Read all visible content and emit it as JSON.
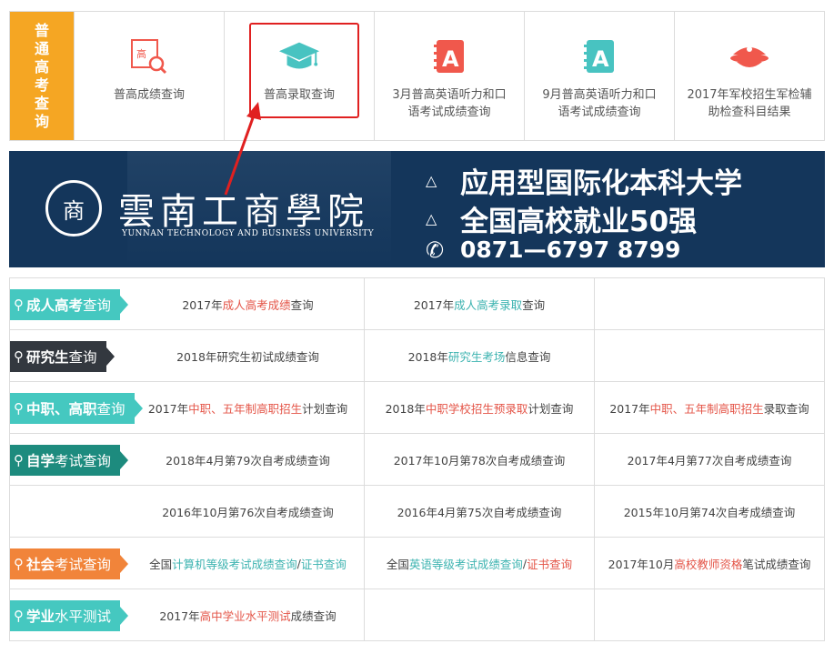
{
  "nav": {
    "vertical_label": [
      "普",
      "通",
      "高",
      "考",
      "查",
      "询"
    ],
    "items": [
      {
        "label": "普高成绩查询",
        "icon": "score-search-icon"
      },
      {
        "label": "普高录取查询",
        "icon": "graduation-cap-icon"
      },
      {
        "label": "3月普高英语听力和口语考试成绩查询",
        "icon": "notebook-a-icon"
      },
      {
        "label": "9月普高英语听力和口语考试成绩查询",
        "icon": "notebook-a-icon"
      },
      {
        "label": "2017年军校招生军检辅助检查科目结果",
        "icon": "military-cap-icon"
      }
    ],
    "colors": {
      "orange": "#f5a623",
      "red": "#f0584c",
      "teal": "#48c3c1"
    }
  },
  "banner": {
    "seal_char": "商",
    "university_cn": "雲南工商學院",
    "university_en": "YUNNAN TECHNOLOGY AND BUSINESS UNIVERSITY",
    "slogan1": "应用型国际化本科大学",
    "slogan2": "全国高校就业50强",
    "phone": "0871—6797 8799",
    "bg_color": "#14365b"
  },
  "rows": [
    {
      "tag": {
        "bold": "成人高考",
        "normal": "查询"
      },
      "cells": [
        [
          {
            "t": "2017年"
          },
          {
            "t": "成人高考成绩",
            "c": "red"
          },
          {
            "t": "查询"
          }
        ],
        [
          {
            "t": "2017年"
          },
          {
            "t": "成人高考录取",
            "c": "tealt"
          },
          {
            "t": "查询"
          }
        ],
        []
      ]
    },
    {
      "tag": {
        "bold": "研究生",
        "normal": "查询"
      },
      "cells": [
        [
          {
            "t": "2018年研究生初试成绩查询"
          }
        ],
        [
          {
            "t": "2018年"
          },
          {
            "t": "研究生考场",
            "c": "tealt"
          },
          {
            "t": "信息查询"
          }
        ],
        []
      ]
    },
    {
      "tag": {
        "bold": "中职、高职",
        "normal": "查询"
      },
      "cells": [
        [
          {
            "t": "2017年"
          },
          {
            "t": "中职、五年制高职招生",
            "c": "red"
          },
          {
            "t": "计划查询"
          }
        ],
        [
          {
            "t": "2018年"
          },
          {
            "t": "中职学校招生预录取",
            "c": "red"
          },
          {
            "t": "计划查询"
          }
        ],
        [
          {
            "t": "2017年"
          },
          {
            "t": "中职、五年制高职招生",
            "c": "red"
          },
          {
            "t": "录取查询"
          }
        ]
      ]
    },
    {
      "tag": {
        "bold": "自学",
        "normal": "考试查询"
      },
      "cells": [
        [
          {
            "t": "2018年4月第79次自考成绩查询"
          }
        ],
        [
          {
            "t": "2017年10月第78次自考成绩查询"
          }
        ],
        [
          {
            "t": "2017年4月第77次自考成绩查询"
          }
        ]
      ]
    },
    {
      "tag": null,
      "cells": [
        [
          {
            "t": "2016年10月第76次自考成绩查询"
          }
        ],
        [
          {
            "t": "2016年4月第75次自考成绩查询"
          }
        ],
        [
          {
            "t": "2015年10月第74次自考成绩查询"
          }
        ]
      ]
    },
    {
      "tag": {
        "bold": "社会",
        "normal": "考试查询"
      },
      "cells": [
        [
          {
            "t": "全国"
          },
          {
            "t": "计算机等级考试成绩查询",
            "c": "tealt"
          },
          {
            "t": " / "
          },
          {
            "t": "证书查询",
            "c": "tealt"
          }
        ],
        [
          {
            "t": "全国"
          },
          {
            "t": "英语等级考试成绩查询",
            "c": "tealt"
          },
          {
            "t": " / "
          },
          {
            "t": "证书查询",
            "c": "red"
          }
        ],
        [
          {
            "t": "2017年10月"
          },
          {
            "t": "高校教师资格",
            "c": "red"
          },
          {
            "t": "笔试成绩查询"
          }
        ]
      ]
    },
    {
      "tag": {
        "bold": "学业",
        "normal": "水平测试"
      },
      "cells": [
        [
          {
            "t": "2017年"
          },
          {
            "t": "高中学业水平测试",
            "c": "red"
          },
          {
            "t": "成绩查询"
          }
        ],
        [],
        []
      ]
    }
  ],
  "tag_colors": [
    "teal",
    "dark",
    "teal",
    "green",
    null,
    "orange",
    "teal"
  ]
}
